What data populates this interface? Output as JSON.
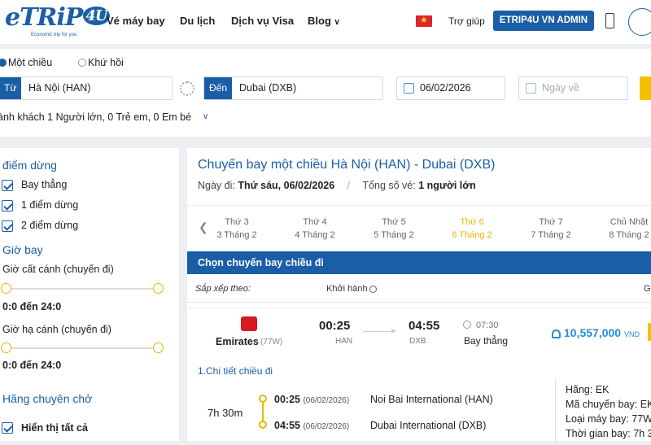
{
  "header": {
    "logo_text": "eTRIP4U",
    "logo_slogan": "Economic trip for you",
    "nav": [
      "Vé máy bay",
      "Du lịch",
      "Dịch vụ Visa",
      "Blog"
    ],
    "help": "Trợ giúp",
    "admin_button": "ETRIP4U VN ADMIN"
  },
  "search": {
    "trip_types": [
      "Một chiều",
      "Khứ hồi"
    ],
    "from_label": "Từ",
    "from_value": "Hà Nội (HAN)",
    "to_label": "Đến",
    "to_value": "Dubai (DXB)",
    "depart_date": "06/02/2026",
    "return_placeholder": "Ngày về",
    "passengers_label": "ành khách",
    "passengers_value": "1 Người lớn, 0 Trẻ em, 0 Em bé"
  },
  "filters": {
    "stops_title": "điểm dừng",
    "stops": [
      "Bay thẳng",
      "1 điểm dừng",
      "2 điểm dừng"
    ],
    "time_title": "Giờ bay",
    "takeoff_label": "Giờ cất cánh (chuyến đi)",
    "takeoff_range": "0:0 đến 24:0",
    "landing_label": "Giờ hạ cánh (chuyến đi)",
    "landing_range": "0:0 đến 24:0",
    "airline_title": "Hãng chuyên chở",
    "airline_all": "Hiển thị tất cả"
  },
  "results": {
    "title": "Chuyến bay một chiều Hà Nội (HAN) - Dubai (DXB)",
    "date_label": "Ngày đi:",
    "date_value": "Thứ sáu, 06/02/2026",
    "tickets_label": "Tổng số vé:",
    "tickets_value": "1 người lớn",
    "days": [
      {
        "dow": "Thứ 3",
        "date": "3 Tháng 2"
      },
      {
        "dow": "Thứ 4",
        "date": "4 Tháng 2"
      },
      {
        "dow": "Thứ 5",
        "date": "5 Tháng 2"
      },
      {
        "dow": "Thứ 6",
        "date": "6 Tháng 2"
      },
      {
        "dow": "Thứ 7",
        "date": "7 Tháng 2"
      },
      {
        "dow": "Chủ Nhật",
        "date": "8 Tháng 2"
      }
    ],
    "selected_day_index": 3,
    "bar_title": "Chọn chuyến bay chiều đi",
    "sort_label": "Sắp xếp theo:",
    "sort_option": "Khởi hành",
    "sort_option2": "Gi",
    "flight": {
      "airline": "Emirates",
      "aircraft": "(77W)",
      "depart_time": "00:25",
      "depart_code": "HAN",
      "arrive_time": "04:55",
      "arrive_code": "DXB",
      "duration": "07:30",
      "stops": "Bay thẳng",
      "price": "10,557,000",
      "currency": "VND"
    },
    "detail": {
      "title": "1.Chi tiết chiều đi",
      "total": "7h 30m",
      "dep_time": "00:25",
      "dep_date": "(06/02/2026)",
      "dep_airport": "Noi Bai International (HAN)",
      "arr_time": "04:55",
      "arr_date": "(06/02/2026)",
      "arr_airport": "Dubai International (DXB)",
      "info": [
        "Hãng: EK",
        "Mã chuyến bay: EK",
        "Loại máy bay: 77W",
        "Thời gian bay: 7h 3"
      ]
    }
  }
}
